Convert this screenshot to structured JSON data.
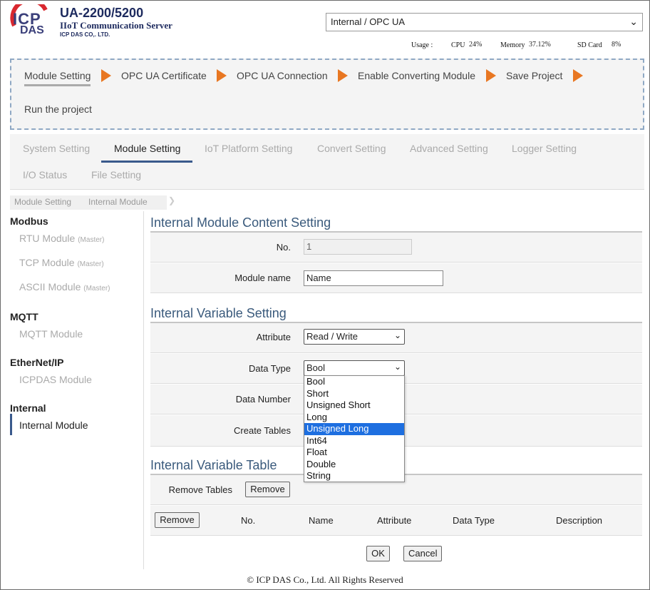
{
  "header": {
    "logo_top": "ICP",
    "logo_bottom": "DAS",
    "product_title": "UA-2200/5200",
    "product_subtitle": "IIoT Communication Server",
    "company": "ICP DAS CO,. LTD.",
    "server_select_value": "Internal / OPC UA",
    "usage_label": "Usage :",
    "cpu_label": "CPU",
    "cpu_value": "24%",
    "memory_label": "Memory",
    "memory_value": "37.12%",
    "sd_label": "SD Card",
    "sd_value": "8%",
    "accent_color": "#e87722"
  },
  "wizard": {
    "steps": [
      "Module Setting",
      "OPC UA Certificate",
      "OPC UA Connection",
      "Enable Converting Module",
      "Save Project",
      "Run the project"
    ]
  },
  "tabs": [
    "System Setting",
    "Module Setting",
    "IoT Platform Setting",
    "Convert Setting",
    "Advanced Setting",
    "Logger Setting",
    "I/O Status",
    "File Setting"
  ],
  "breadcrumb": [
    "Module Setting",
    "Internal Module"
  ],
  "sidebar": {
    "groups": [
      {
        "title": "Modbus",
        "items": [
          {
            "label": "RTU Module",
            "tag": "(Master)"
          },
          {
            "label": "TCP Module",
            "tag": "(Master)"
          },
          {
            "label": "ASCII Module",
            "tag": "(Master)"
          }
        ]
      },
      {
        "title": "MQTT",
        "items": [
          {
            "label": "MQTT Module",
            "tag": ""
          }
        ]
      },
      {
        "title": "EtherNet/IP",
        "items": [
          {
            "label": "ICPDAS Module",
            "tag": ""
          }
        ]
      },
      {
        "title": "Internal",
        "items": [
          {
            "label": "Internal Module",
            "tag": ""
          }
        ]
      }
    ]
  },
  "content": {
    "section1_title": "Internal Module Content Setting",
    "no_label": "No.",
    "no_value": "1",
    "module_name_label": "Module name",
    "module_name_value": "Name",
    "section2_title": "Internal Variable Setting",
    "attribute_label": "Attribute",
    "attribute_value": "Read / Write",
    "data_type_label": "Data Type",
    "data_type_value": "Bool",
    "data_type_options": [
      "Bool",
      "Short",
      "Unsigned Short",
      "Long",
      "Unsigned Long",
      "Int64",
      "Float",
      "Double",
      "String"
    ],
    "data_type_highlighted": "Unsigned Long",
    "data_number_label": "Data Number",
    "create_tables_label": "Create Tables",
    "section3_title": "Internal Variable Table",
    "remove_tables_label": "Remove Tables",
    "remove_button": "Remove",
    "table_headers": [
      "No.",
      "Name",
      "Attribute",
      "Data Type",
      "Description"
    ],
    "table_remove_button": "Remove",
    "ok_button": "OK",
    "cancel_button": "Cancel"
  },
  "footer": "© ICP DAS Co., Ltd. All Rights Reserved"
}
